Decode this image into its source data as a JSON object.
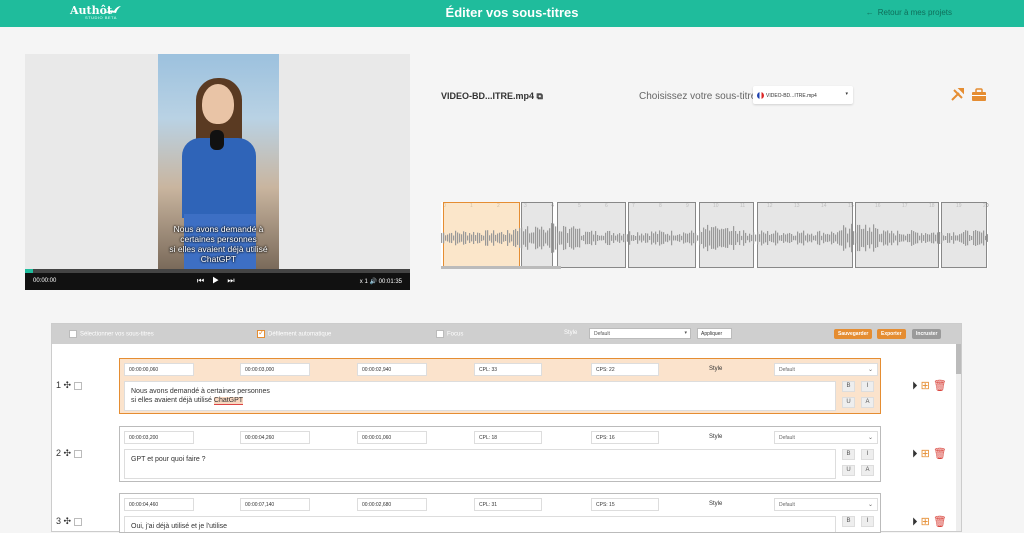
{
  "header": {
    "logo": "Authôt",
    "logo_sub": "STUDIO BETA",
    "title": "Éditer vos sous-titres",
    "back_label": "Retour à mes projets"
  },
  "video": {
    "caption_lines": [
      "Nous avons demandé à",
      "certaines personnes",
      "si elles avaient déjà utilisé",
      "ChatGPT"
    ],
    "time_current": "00:00:00",
    "time_total": "00:01:35",
    "speed": "x 1",
    "progress": 0.02
  },
  "file": {
    "name": "VIDEO-BD...ITRE.mp4",
    "choose_label": "Choisissez votre sous-titre",
    "subtitle_selected": "VIDEO-BD...ITRE.mp4"
  },
  "waveform": {
    "ticks": [
      "0",
      "1",
      "2",
      "3",
      "4",
      "5",
      "6",
      "7",
      "8",
      "9",
      "10",
      "11",
      "12",
      "13",
      "14",
      "15",
      "16",
      "17",
      "18",
      "19",
      "20"
    ]
  },
  "toolbar": {
    "select_all": "Sélectionner vos sous-titres",
    "auto_scroll": "Défilement automatique",
    "focus": "Focus",
    "style_label": "Style",
    "style_value": "Default",
    "apply": "Appliquer",
    "save": "Sauvegarder",
    "export": "Exporter",
    "embed": "Incruster",
    "colors": {
      "save": "#e58d32",
      "export": "#e58d32",
      "embed": "#9a9a9a"
    }
  },
  "rows": [
    {
      "num": "1",
      "start": "00:00:00,060",
      "end": "00:00:03,000",
      "duration": "00:00:02,940",
      "cpl": "CPL: 33",
      "cps": "CPS: 22",
      "style_label": "Style",
      "style_value": "Default",
      "line1": "Nous avons demandé à certaines personnes",
      "line2_pre": "si elles avaient déjà utilisé ",
      "line2_hl": "ChatGPT"
    },
    {
      "num": "2",
      "start": "00:00:03,200",
      "end": "00:00:04,260",
      "duration": "00:00:01,060",
      "cpl": "CPL: 18",
      "cps": "CPS: 16",
      "style_label": "Style",
      "style_value": "Default",
      "line1": "GPT et pour quoi faire ?"
    },
    {
      "num": "3",
      "start": "00:00:04,460",
      "end": "00:00:07,140",
      "duration": "00:00:02,680",
      "cpl": "CPL: 31",
      "cps": "CPS: 15",
      "style_label": "Style",
      "style_value": "Default",
      "line1": "Oui, j'ai déjà utilisé et je l'utilise"
    }
  ],
  "format_buttons": [
    "B",
    "I",
    "U",
    "A"
  ]
}
